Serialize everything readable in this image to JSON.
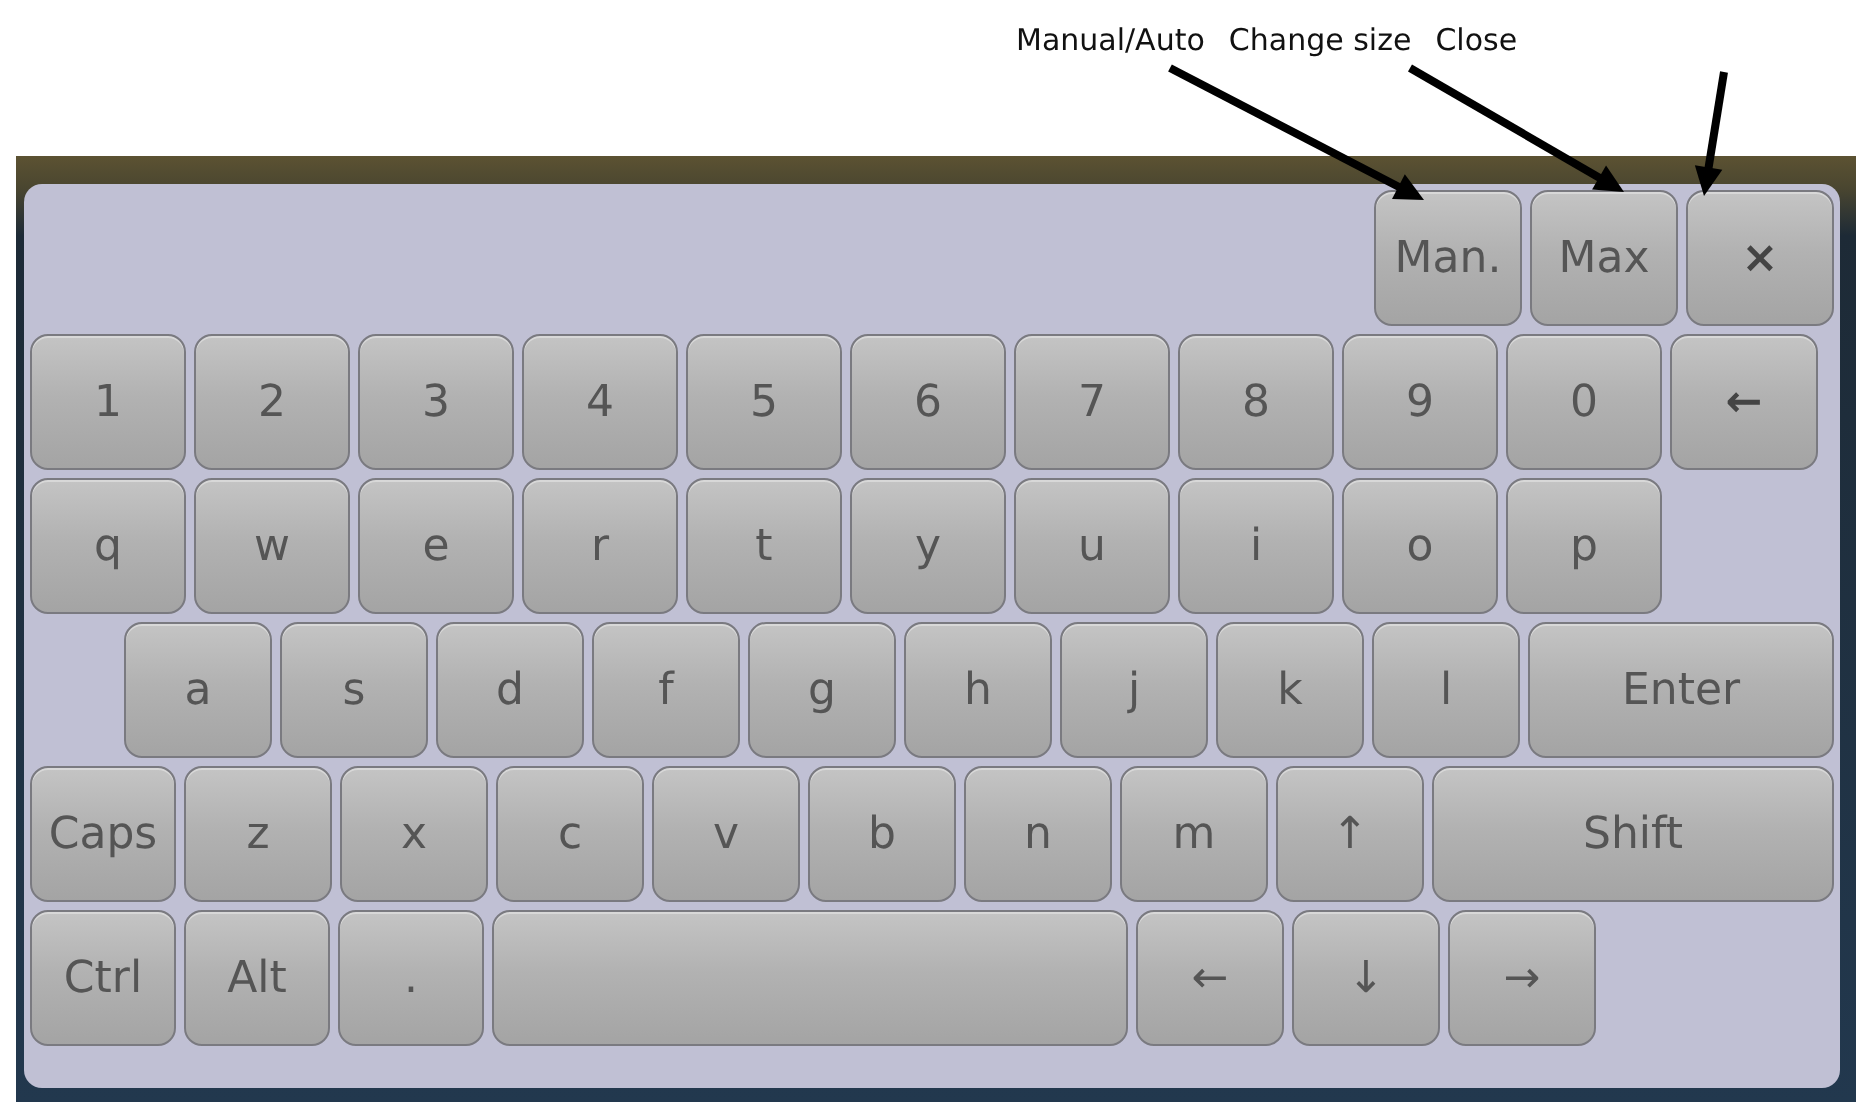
{
  "annotations": [
    {
      "label": "Manual/Auto"
    },
    {
      "label": "Change size"
    },
    {
      "label": "Close"
    }
  ],
  "keyboard": {
    "top_buttons": [
      {
        "label": "Man."
      },
      {
        "label": "Max"
      },
      {
        "label": "×"
      }
    ],
    "rows": [
      [
        {
          "label": "1",
          "kind": "key"
        },
        {
          "label": "2",
          "kind": "key"
        },
        {
          "label": "3",
          "kind": "key"
        },
        {
          "label": "4",
          "kind": "key"
        },
        {
          "label": "5",
          "kind": "key"
        },
        {
          "label": "6",
          "kind": "key"
        },
        {
          "label": "7",
          "kind": "key"
        },
        {
          "label": "8",
          "kind": "key"
        },
        {
          "label": "9",
          "kind": "key"
        },
        {
          "label": "0",
          "kind": "key"
        },
        {
          "label": "←",
          "kind": "bold"
        }
      ],
      [
        {
          "label": "q",
          "kind": "key"
        },
        {
          "label": "w",
          "kind": "key"
        },
        {
          "label": "e",
          "kind": "key"
        },
        {
          "label": "r",
          "kind": "key"
        },
        {
          "label": "t",
          "kind": "key"
        },
        {
          "label": "y",
          "kind": "key"
        },
        {
          "label": "u",
          "kind": "key"
        },
        {
          "label": "i",
          "kind": "key"
        },
        {
          "label": "o",
          "kind": "key"
        },
        {
          "label": "p",
          "kind": "key"
        }
      ],
      [
        {
          "label": "a",
          "kind": "key"
        },
        {
          "label": "s",
          "kind": "key"
        },
        {
          "label": "d",
          "kind": "key"
        },
        {
          "label": "f",
          "kind": "key"
        },
        {
          "label": "g",
          "kind": "key"
        },
        {
          "label": "h",
          "kind": "key"
        },
        {
          "label": "j",
          "kind": "key"
        },
        {
          "label": "k",
          "kind": "key"
        },
        {
          "label": "l",
          "kind": "key"
        },
        {
          "label": "Enter",
          "kind": "fill"
        }
      ],
      [
        {
          "label": "Caps",
          "kind": "mod"
        },
        {
          "label": "z",
          "kind": "key"
        },
        {
          "label": "x",
          "kind": "key"
        },
        {
          "label": "c",
          "kind": "key"
        },
        {
          "label": "v",
          "kind": "key"
        },
        {
          "label": "b",
          "kind": "key"
        },
        {
          "label": "n",
          "kind": "key"
        },
        {
          "label": "m",
          "kind": "key"
        },
        {
          "label": "↑",
          "kind": "key"
        },
        {
          "label": "Shift",
          "kind": "fill"
        }
      ],
      [
        {
          "label": "Ctrl",
          "kind": "mod"
        },
        {
          "label": "Alt",
          "kind": "mod"
        },
        {
          "label": ".",
          "kind": "mod"
        },
        {
          "kind": "space"
        },
        {
          "label": "←",
          "kind": "key"
        },
        {
          "label": "↓",
          "kind": "key"
        },
        {
          "label": "→",
          "kind": "key"
        }
      ]
    ]
  }
}
